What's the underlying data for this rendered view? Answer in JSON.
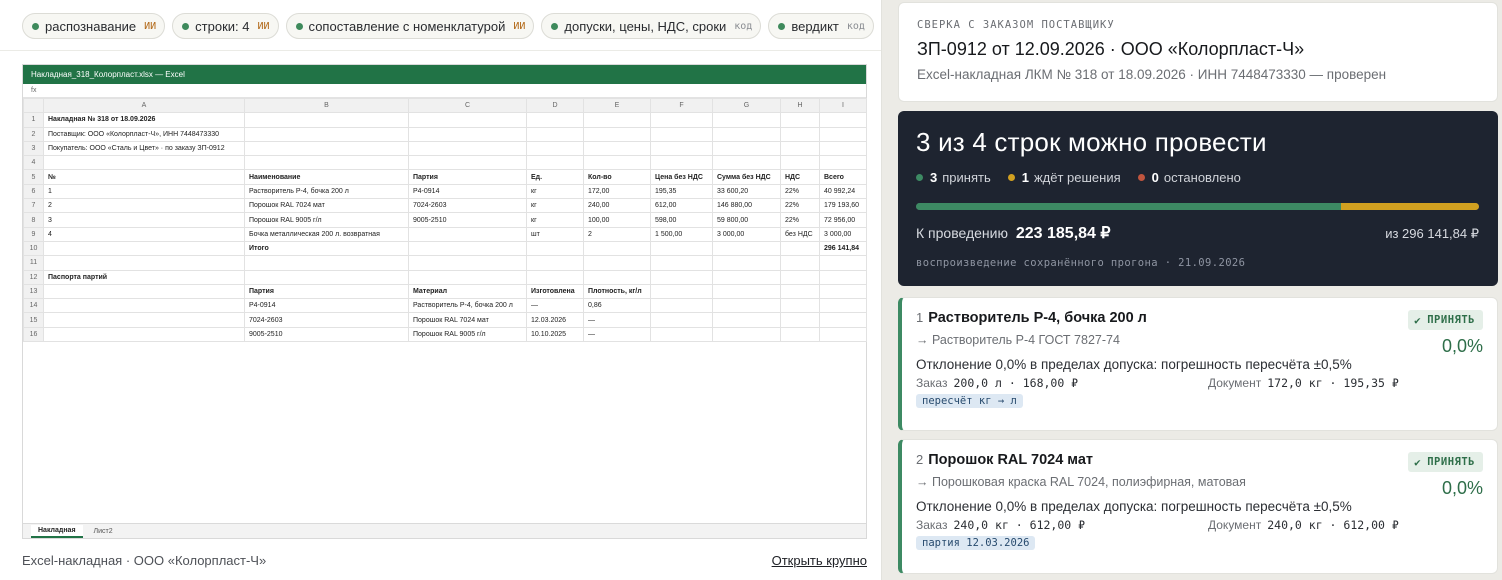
{
  "pipeline": {
    "chips": [
      {
        "label": "распознавание",
        "tag": "ИИ"
      },
      {
        "label": "строки: 4",
        "tag": "ИИ"
      },
      {
        "label": "сопоставление с номенклатурой",
        "tag": "ИИ"
      },
      {
        "label": "допуски, цены, НДС, сроки",
        "tag": "код"
      },
      {
        "label": "вердикт",
        "tag": "код"
      }
    ]
  },
  "excel": {
    "window_title": "Накладная_318_Колорпласт.xlsx — Excel",
    "formula_label": "fx",
    "columns": [
      "A",
      "B",
      "C",
      "D",
      "E",
      "F",
      "G",
      "H",
      "I"
    ],
    "rows": [
      [
        "Накладная № 318 от 18.09.2026",
        "",
        "",
        "",
        "",
        "",
        "",
        "",
        ""
      ],
      [
        "Поставщик: ООО «Колорпласт-Ч», ИНН 7448473330",
        "",
        "",
        "",
        "",
        "",
        "",
        "",
        ""
      ],
      [
        "Покупатель: ООО «Сталь и Цвет» · по заказу ЗП-0912",
        "",
        "",
        "",
        "",
        "",
        "",
        "",
        ""
      ],
      [
        "",
        "",
        "",
        "",
        "",
        "",
        "",
        "",
        ""
      ],
      [
        "№",
        "Наименование",
        "Партия",
        "Ед.",
        "Кол-во",
        "Цена без НДС",
        "Сумма без НДС",
        "НДС",
        "Всего"
      ],
      [
        "1",
        "Растворитель Р-4, бочка 200 л",
        "Р4-0914",
        "кг",
        "172,00",
        "195,35",
        "33 600,20",
        "22%",
        "40 992,24"
      ],
      [
        "2",
        "Порошок RAL 7024 мат",
        "7024-2603",
        "кг",
        "240,00",
        "612,00",
        "146 880,00",
        "22%",
        "179 193,60"
      ],
      [
        "3",
        "Порошок RAL 9005 г/л",
        "9005-2510",
        "кг",
        "100,00",
        "598,00",
        "59 800,00",
        "22%",
        "72 956,00"
      ],
      [
        "4",
        "Бочка металлическая 200 л. возвратная",
        "",
        "шт",
        "2",
        "1 500,00",
        "3 000,00",
        "без НДС",
        "3 000,00"
      ],
      [
        "",
        "Итого",
        "",
        "",
        "",
        "",
        "",
        "",
        "296 141,84"
      ],
      [
        "",
        "",
        "",
        "",
        "",
        "",
        "",
        "",
        ""
      ],
      [
        "Паспорта партий",
        "",
        "",
        "",
        "",
        "",
        "",
        "",
        ""
      ],
      [
        "",
        "Партия",
        "Материал",
        "Изготовлена",
        "Плотность, кг/л",
        "",
        "",
        "",
        ""
      ],
      [
        "",
        "Р4-0914",
        "Растворитель Р-4, бочка 200 л",
        "—",
        "0,86",
        "",
        "",
        "",
        ""
      ],
      [
        "",
        "7024-2603",
        "Порошок RAL 7024 мат",
        "12.03.2026",
        "—",
        "",
        "",
        "",
        ""
      ],
      [
        "",
        "9005-2510",
        "Порошок RAL 9005 г/л",
        "10.10.2025",
        "—",
        "",
        "",
        "",
        ""
      ]
    ],
    "sheets": [
      "Накладная",
      "Лист2"
    ],
    "active_sheet": 0
  },
  "left_footer": {
    "caption": "Excel-накладная · ООО «Колорпласт-Ч»",
    "open_link": "Открыть крупно"
  },
  "header": {
    "eyebrow": "СВЕРКА С ЗАКАЗОМ ПОСТАВЩИКУ",
    "title": "ЗП-0912 от 12.09.2026 · ООО «Колорпласт-Ч»",
    "subtitle": "Excel-накладная ЛКМ № 318 от 18.09.2026 · ИНН 7448473330 — проверен"
  },
  "summary": {
    "title": "3 из 4 строк можно провести",
    "legend": [
      {
        "count": "3",
        "label": "принять",
        "color": "#3d8a63"
      },
      {
        "count": "1",
        "label": "ждёт решения",
        "color": "#d1a020"
      },
      {
        "count": "0",
        "label": "остановлено",
        "color": "#c0553e"
      }
    ],
    "progress": {
      "accepted_fraction": 0.754,
      "pending_fraction": 0.246
    },
    "to_post_label": "К проведению",
    "to_post_value": "223 185,84 ₽",
    "total_label": "из 296 141,84 ₽",
    "replay": "воспроизведение сохранённого прогона · 21.09.2026"
  },
  "lines": [
    {
      "num": "1",
      "title": "Растворитель Р-4, бочка 200 л",
      "match": "→ Растворитель Р-4 ГОСТ 7827-74",
      "badge": "ПРИНЯТЬ",
      "pct": "0,0%",
      "deviation": "Отклонение 0,0% в пределах допуска: погрешность пересчёта ±0,5%",
      "order_label": "Заказ",
      "order_value": "200,0 л · 168,00 ₽",
      "doc_label": "Документ",
      "doc_value": "172,0 кг · 195,35 ₽",
      "chip": "пересчёт кг → л"
    },
    {
      "num": "2",
      "title": "Порошок RAL 7024 мат",
      "match": "→ Порошковая краска RAL 7024, полиэфирная, матовая",
      "badge": "ПРИНЯТЬ",
      "pct": "0,0%",
      "deviation": "Отклонение 0,0% в пределах допуска: погрешность пересчёта ±0,5%",
      "order_label": "Заказ",
      "order_value": "240,0 кг · 612,00 ₽",
      "doc_label": "Документ",
      "doc_value": "240,0 кг · 612,00 ₽",
      "chip": "партия 12.03.2026"
    }
  ]
}
